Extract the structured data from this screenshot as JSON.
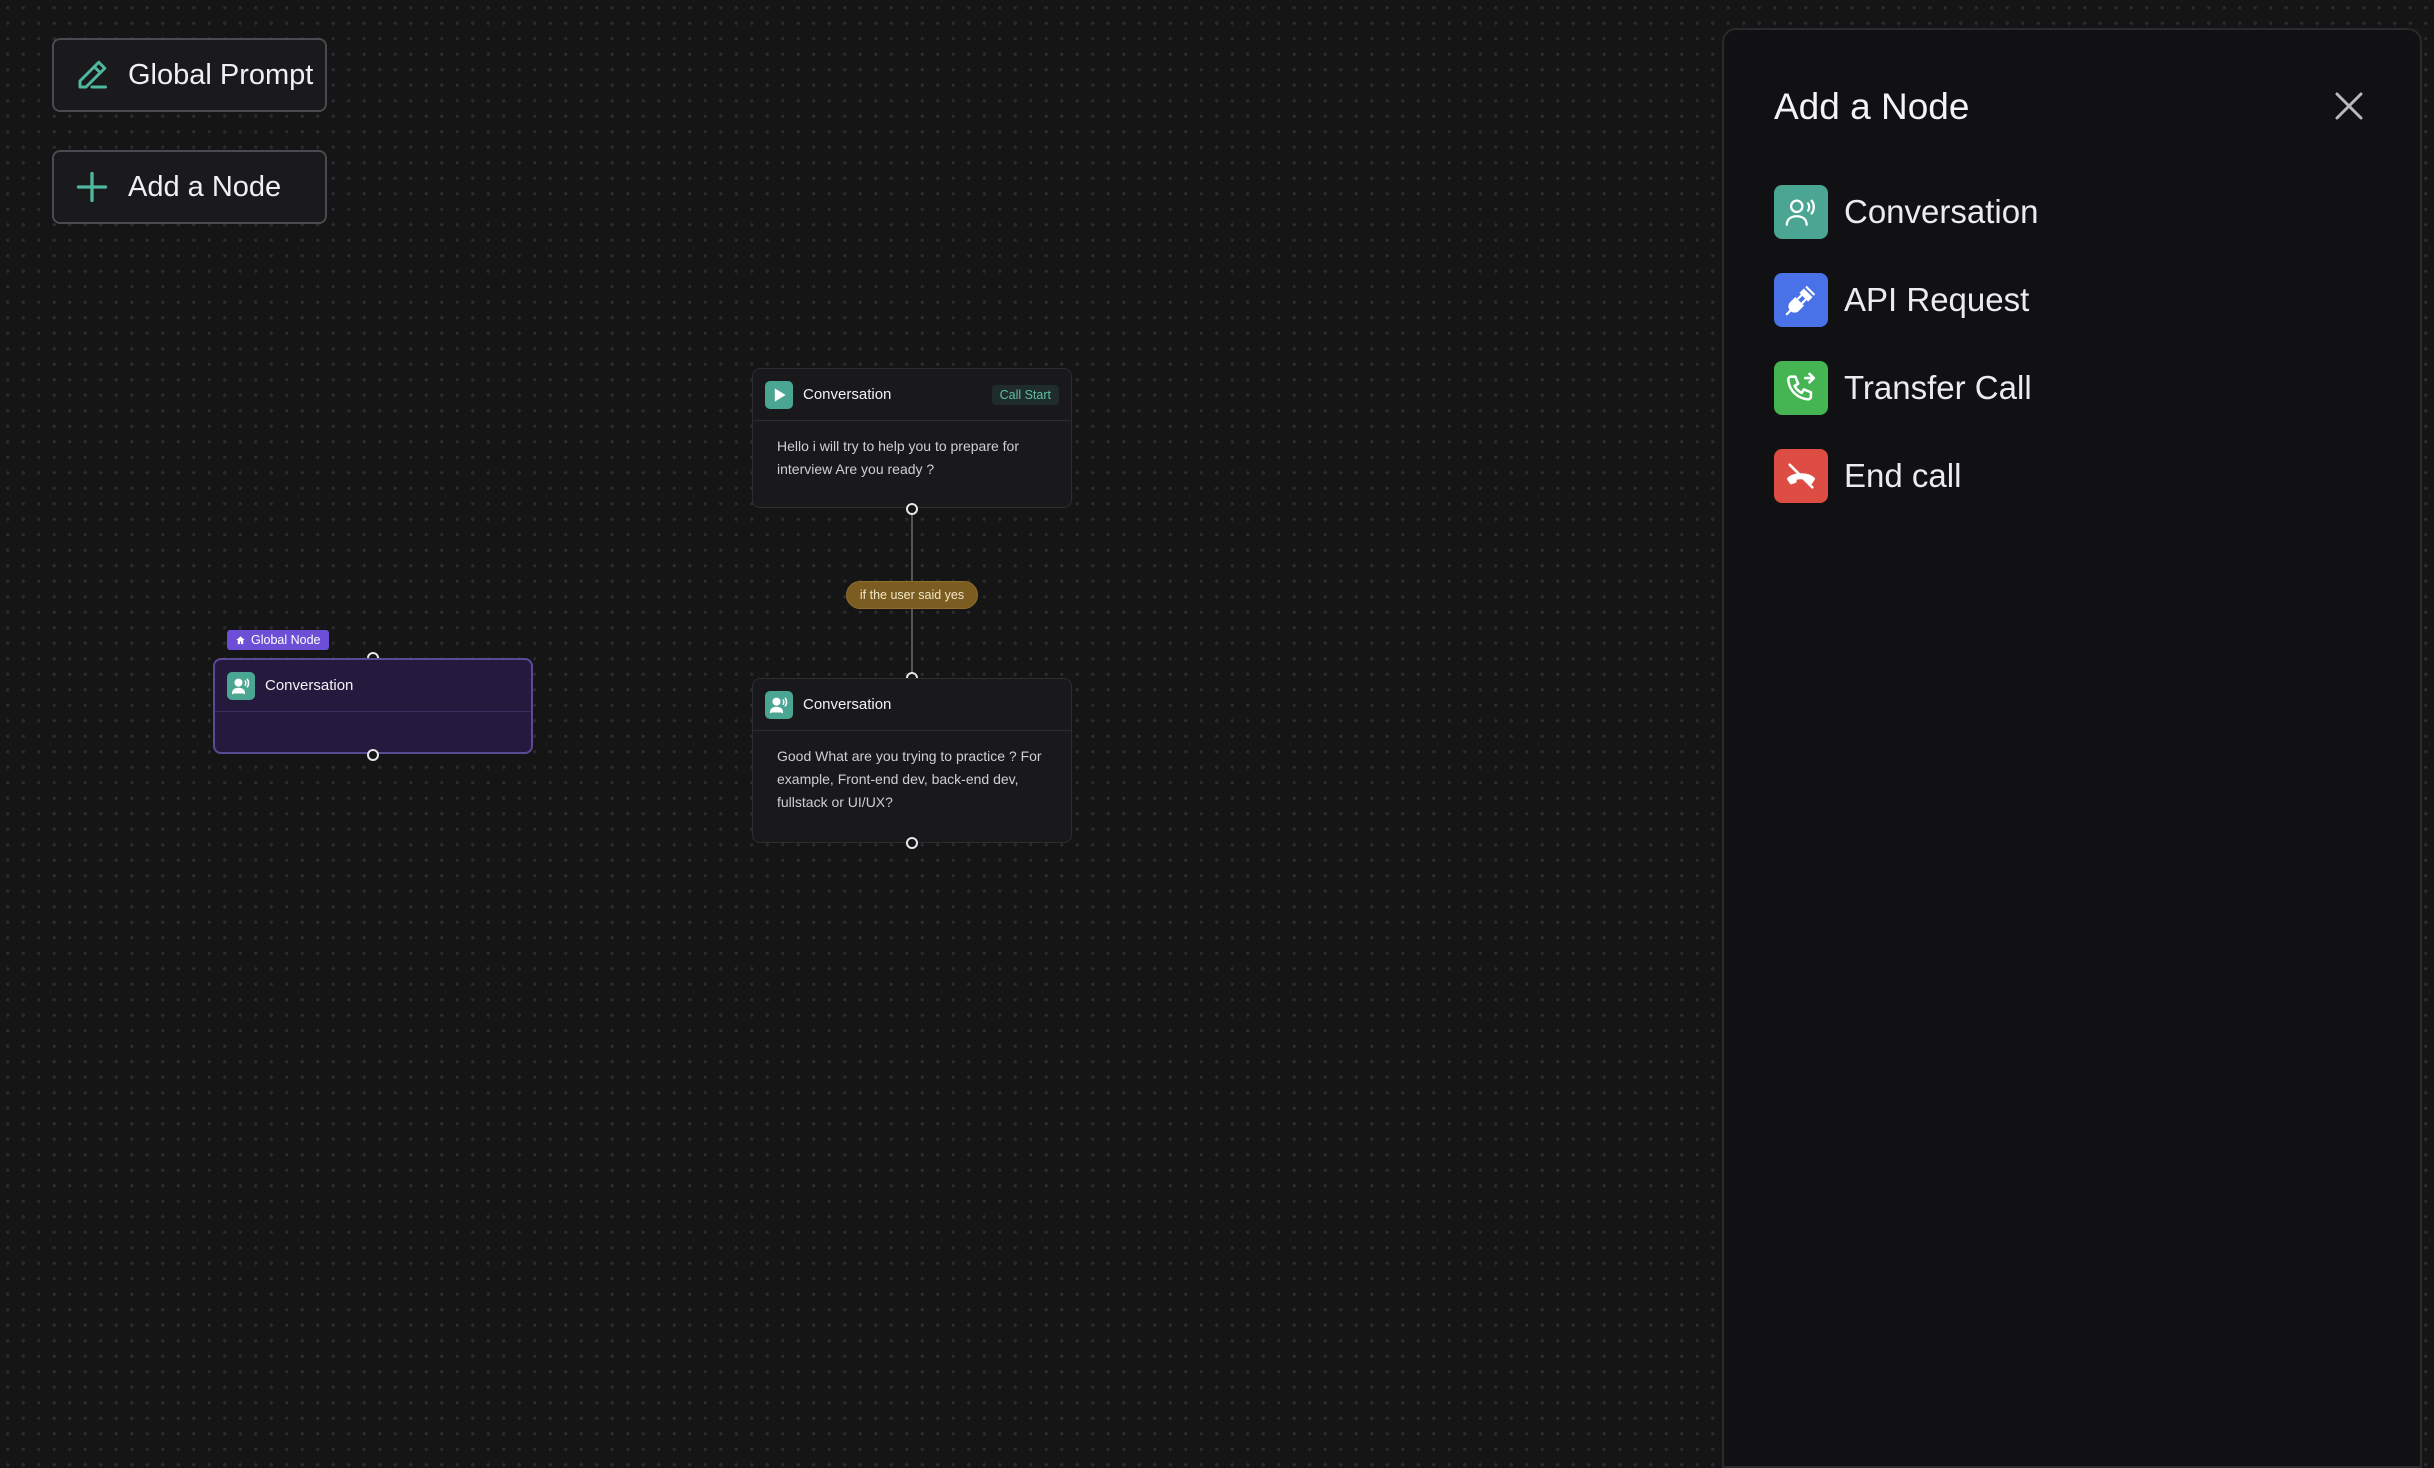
{
  "toolbar": {
    "global_prompt_label": "Global Prompt",
    "add_node_label": "Add a Node"
  },
  "canvas": {
    "start_node": {
      "title": "Conversation",
      "tag": "Call Start",
      "text": "Hello i will try to help you to prepare for interview Are you ready ?"
    },
    "edge_label": "if the user said yes",
    "second_node": {
      "title": "Conversation",
      "text": "Good What are you trying to practice ? For example, Front-end dev, back-end dev, fullstack or UI/UX?"
    },
    "global_node": {
      "badge": "Global Node",
      "title": "Conversation"
    }
  },
  "panel": {
    "title": "Add a Node",
    "items": [
      {
        "label": "Conversation",
        "icon": "conversation-icon",
        "color": "#4aa592"
      },
      {
        "label": "API Request",
        "icon": "plug-icon",
        "color": "#4a72e8"
      },
      {
        "label": "Transfer Call",
        "icon": "phone-transfer-icon",
        "color": "#45b553"
      },
      {
        "label": "End call",
        "icon": "phone-hangup-icon",
        "color": "#dd4d43"
      }
    ]
  },
  "colors": {
    "accent": "#4aa592",
    "global_node": "#6c4fd6",
    "edge_label": "#7b5d22"
  }
}
